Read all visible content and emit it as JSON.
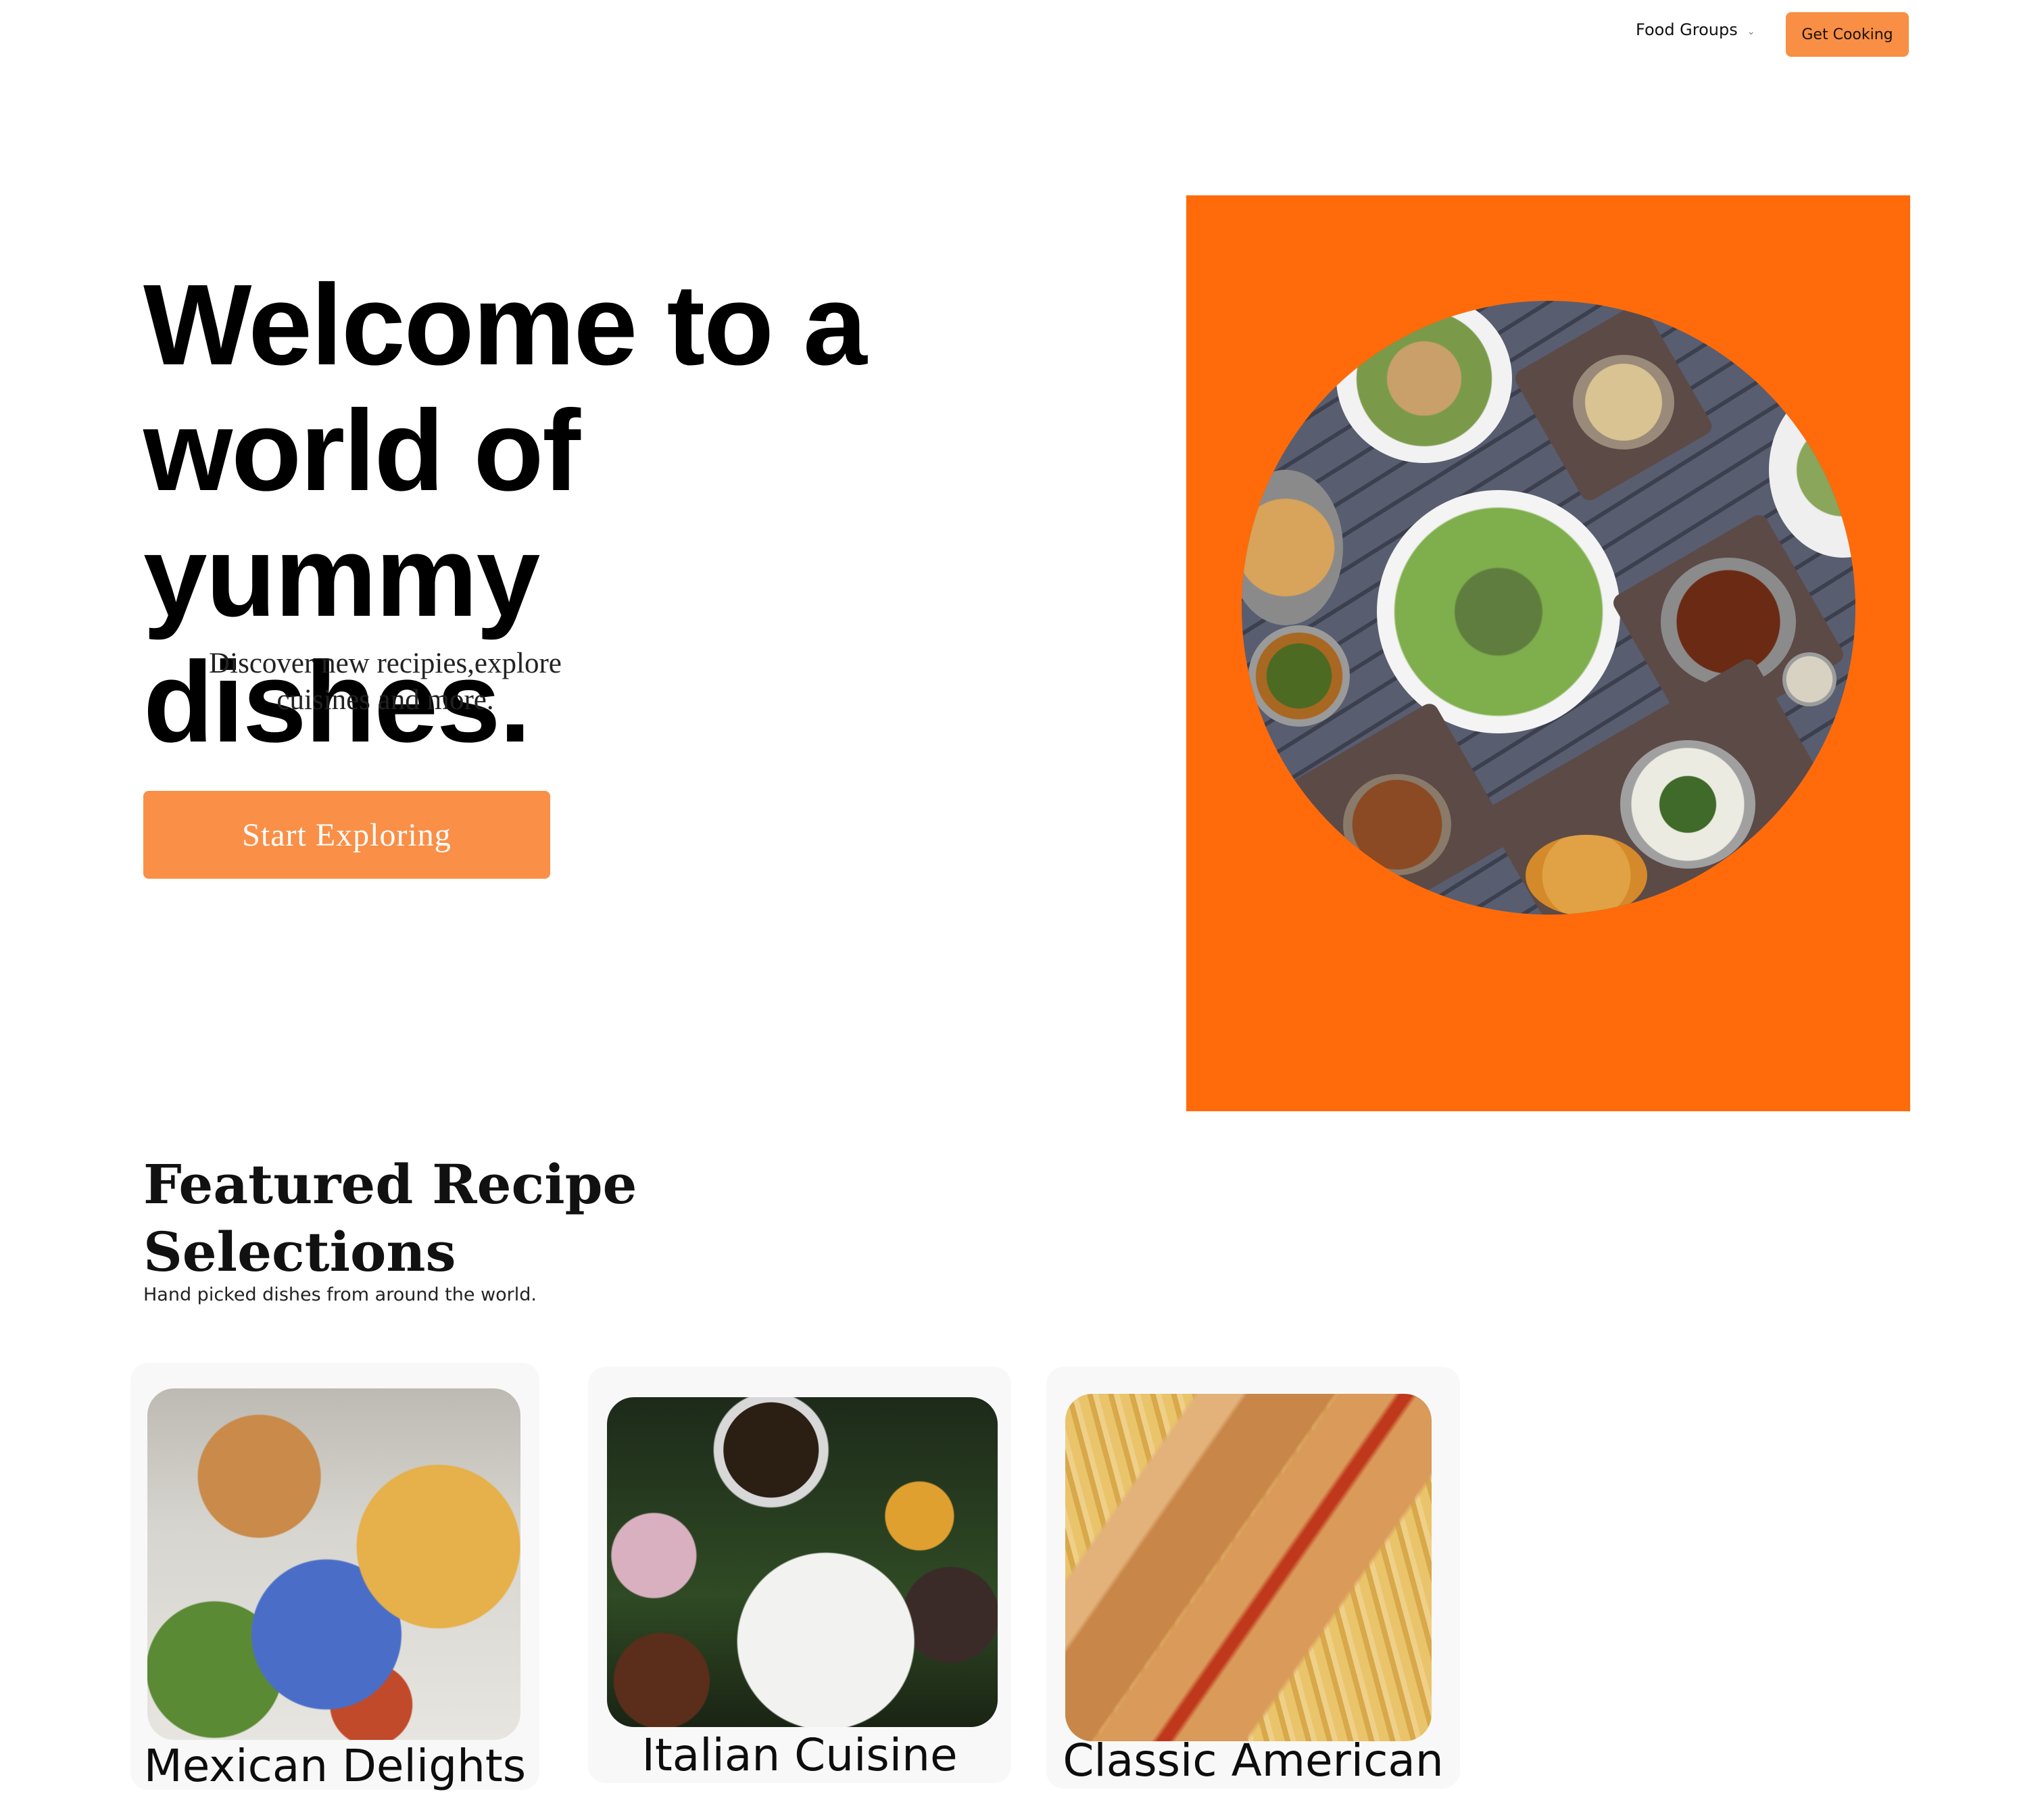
{
  "nav": {
    "food_groups_label": "Food Groups",
    "cta_label": "Get Cooking"
  },
  "hero": {
    "title": "Welcome  to a\nworld of\nyummy dishes.",
    "subtitle": "Discover new recipies,explore cuisines and more.",
    "button_label": "Start Exploring"
  },
  "featured": {
    "title": "Featured Recipe\nSelections",
    "subtitle": "Hand picked dishes from around the world.",
    "cards": [
      {
        "label": "Mexican Delights",
        "image": "mexican-food-photo"
      },
      {
        "label": "Italian Cuisine",
        "image": "italian-food-photo"
      },
      {
        "label": "Classic American",
        "image": "hotdog-fries-photo"
      }
    ]
  },
  "colors": {
    "accent": "#fa8f47",
    "hero_panel": "#ff6b0a",
    "card_bg": "#f8f8f8"
  }
}
